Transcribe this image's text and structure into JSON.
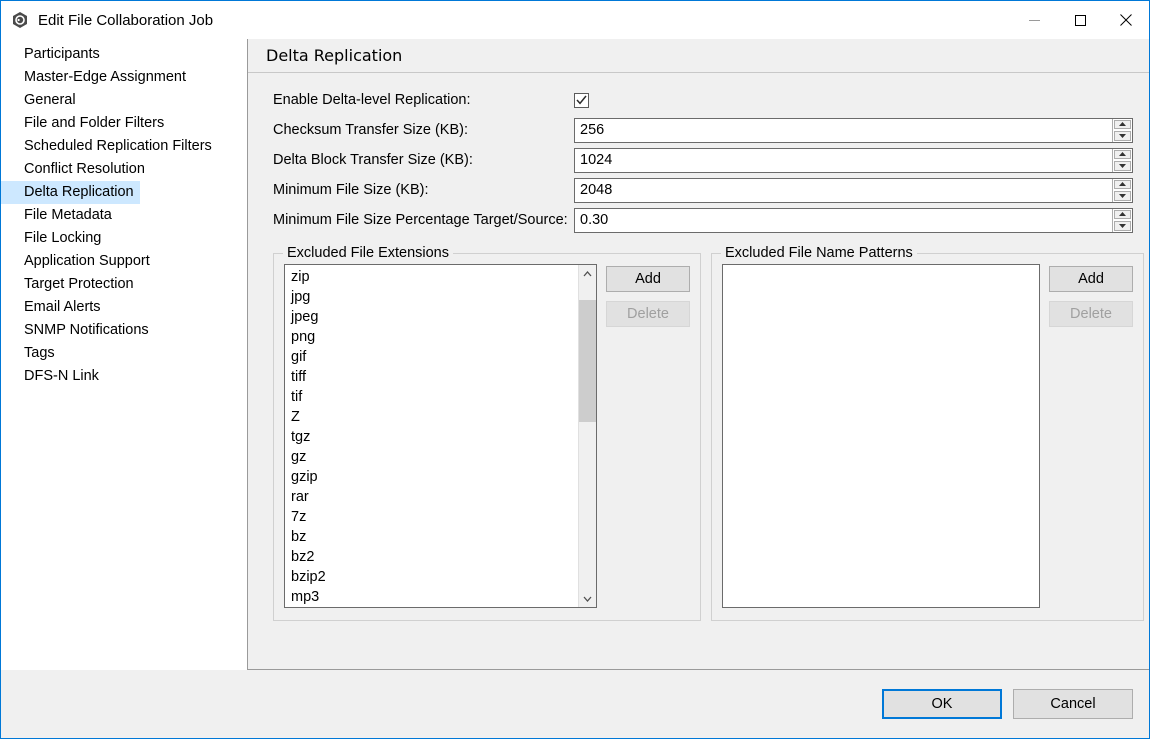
{
  "window": {
    "title": "Edit File Collaboration Job",
    "app_icon": "hexagon-app-icon",
    "accent_color": "#0078d7",
    "controls": {
      "minimize": "minimize-icon",
      "maximize": "maximize-icon",
      "close": "close-icon"
    }
  },
  "sidebar": {
    "items": [
      {
        "label": "Participants",
        "selected": false
      },
      {
        "label": "Master-Edge Assignment",
        "selected": false
      },
      {
        "label": "General",
        "selected": false
      },
      {
        "label": "File and Folder Filters",
        "selected": false
      },
      {
        "label": "Scheduled Replication Filters",
        "selected": false
      },
      {
        "label": "Conflict Resolution",
        "selected": false
      },
      {
        "label": "Delta Replication",
        "selected": true
      },
      {
        "label": "File Metadata",
        "selected": false
      },
      {
        "label": "File Locking",
        "selected": false
      },
      {
        "label": "Application Support",
        "selected": false
      },
      {
        "label": "Target Protection",
        "selected": false
      },
      {
        "label": "Email Alerts",
        "selected": false
      },
      {
        "label": "SNMP Notifications",
        "selected": false
      },
      {
        "label": "Tags",
        "selected": false
      },
      {
        "label": "DFS-N Link",
        "selected": false
      }
    ],
    "selected_color": "#cde8ff"
  },
  "panel": {
    "header": "Delta Replication",
    "fields": {
      "enable_delta": {
        "label": "Enable Delta-level Replication:",
        "checked": true
      },
      "checksum_transfer_size": {
        "label": "Checksum Transfer Size (KB):",
        "value": "256"
      },
      "delta_block_transfer_size": {
        "label": "Delta Block Transfer Size (KB):",
        "value": "1024"
      },
      "minimum_file_size": {
        "label": "Minimum File Size (KB):",
        "value": "2048"
      },
      "minimum_file_size_percentage": {
        "label": "Minimum File Size Percentage Target/Source:",
        "value": "0.30"
      }
    },
    "excluded_extensions": {
      "title": "Excluded File Extensions",
      "items": [
        "zip",
        "jpg",
        "jpeg",
        "png",
        "gif",
        "tiff",
        "tif",
        "Z",
        "tgz",
        "gz",
        "gzip",
        "rar",
        "7z",
        "bz",
        "bz2",
        "bzip2",
        "mp3"
      ],
      "add_label": "Add",
      "delete_label": "Delete",
      "delete_enabled": false
    },
    "excluded_patterns": {
      "title": "Excluded File Name Patterns",
      "items": [],
      "add_label": "Add",
      "delete_label": "Delete",
      "delete_enabled": false
    }
  },
  "footer": {
    "ok_label": "OK",
    "cancel_label": "Cancel"
  }
}
